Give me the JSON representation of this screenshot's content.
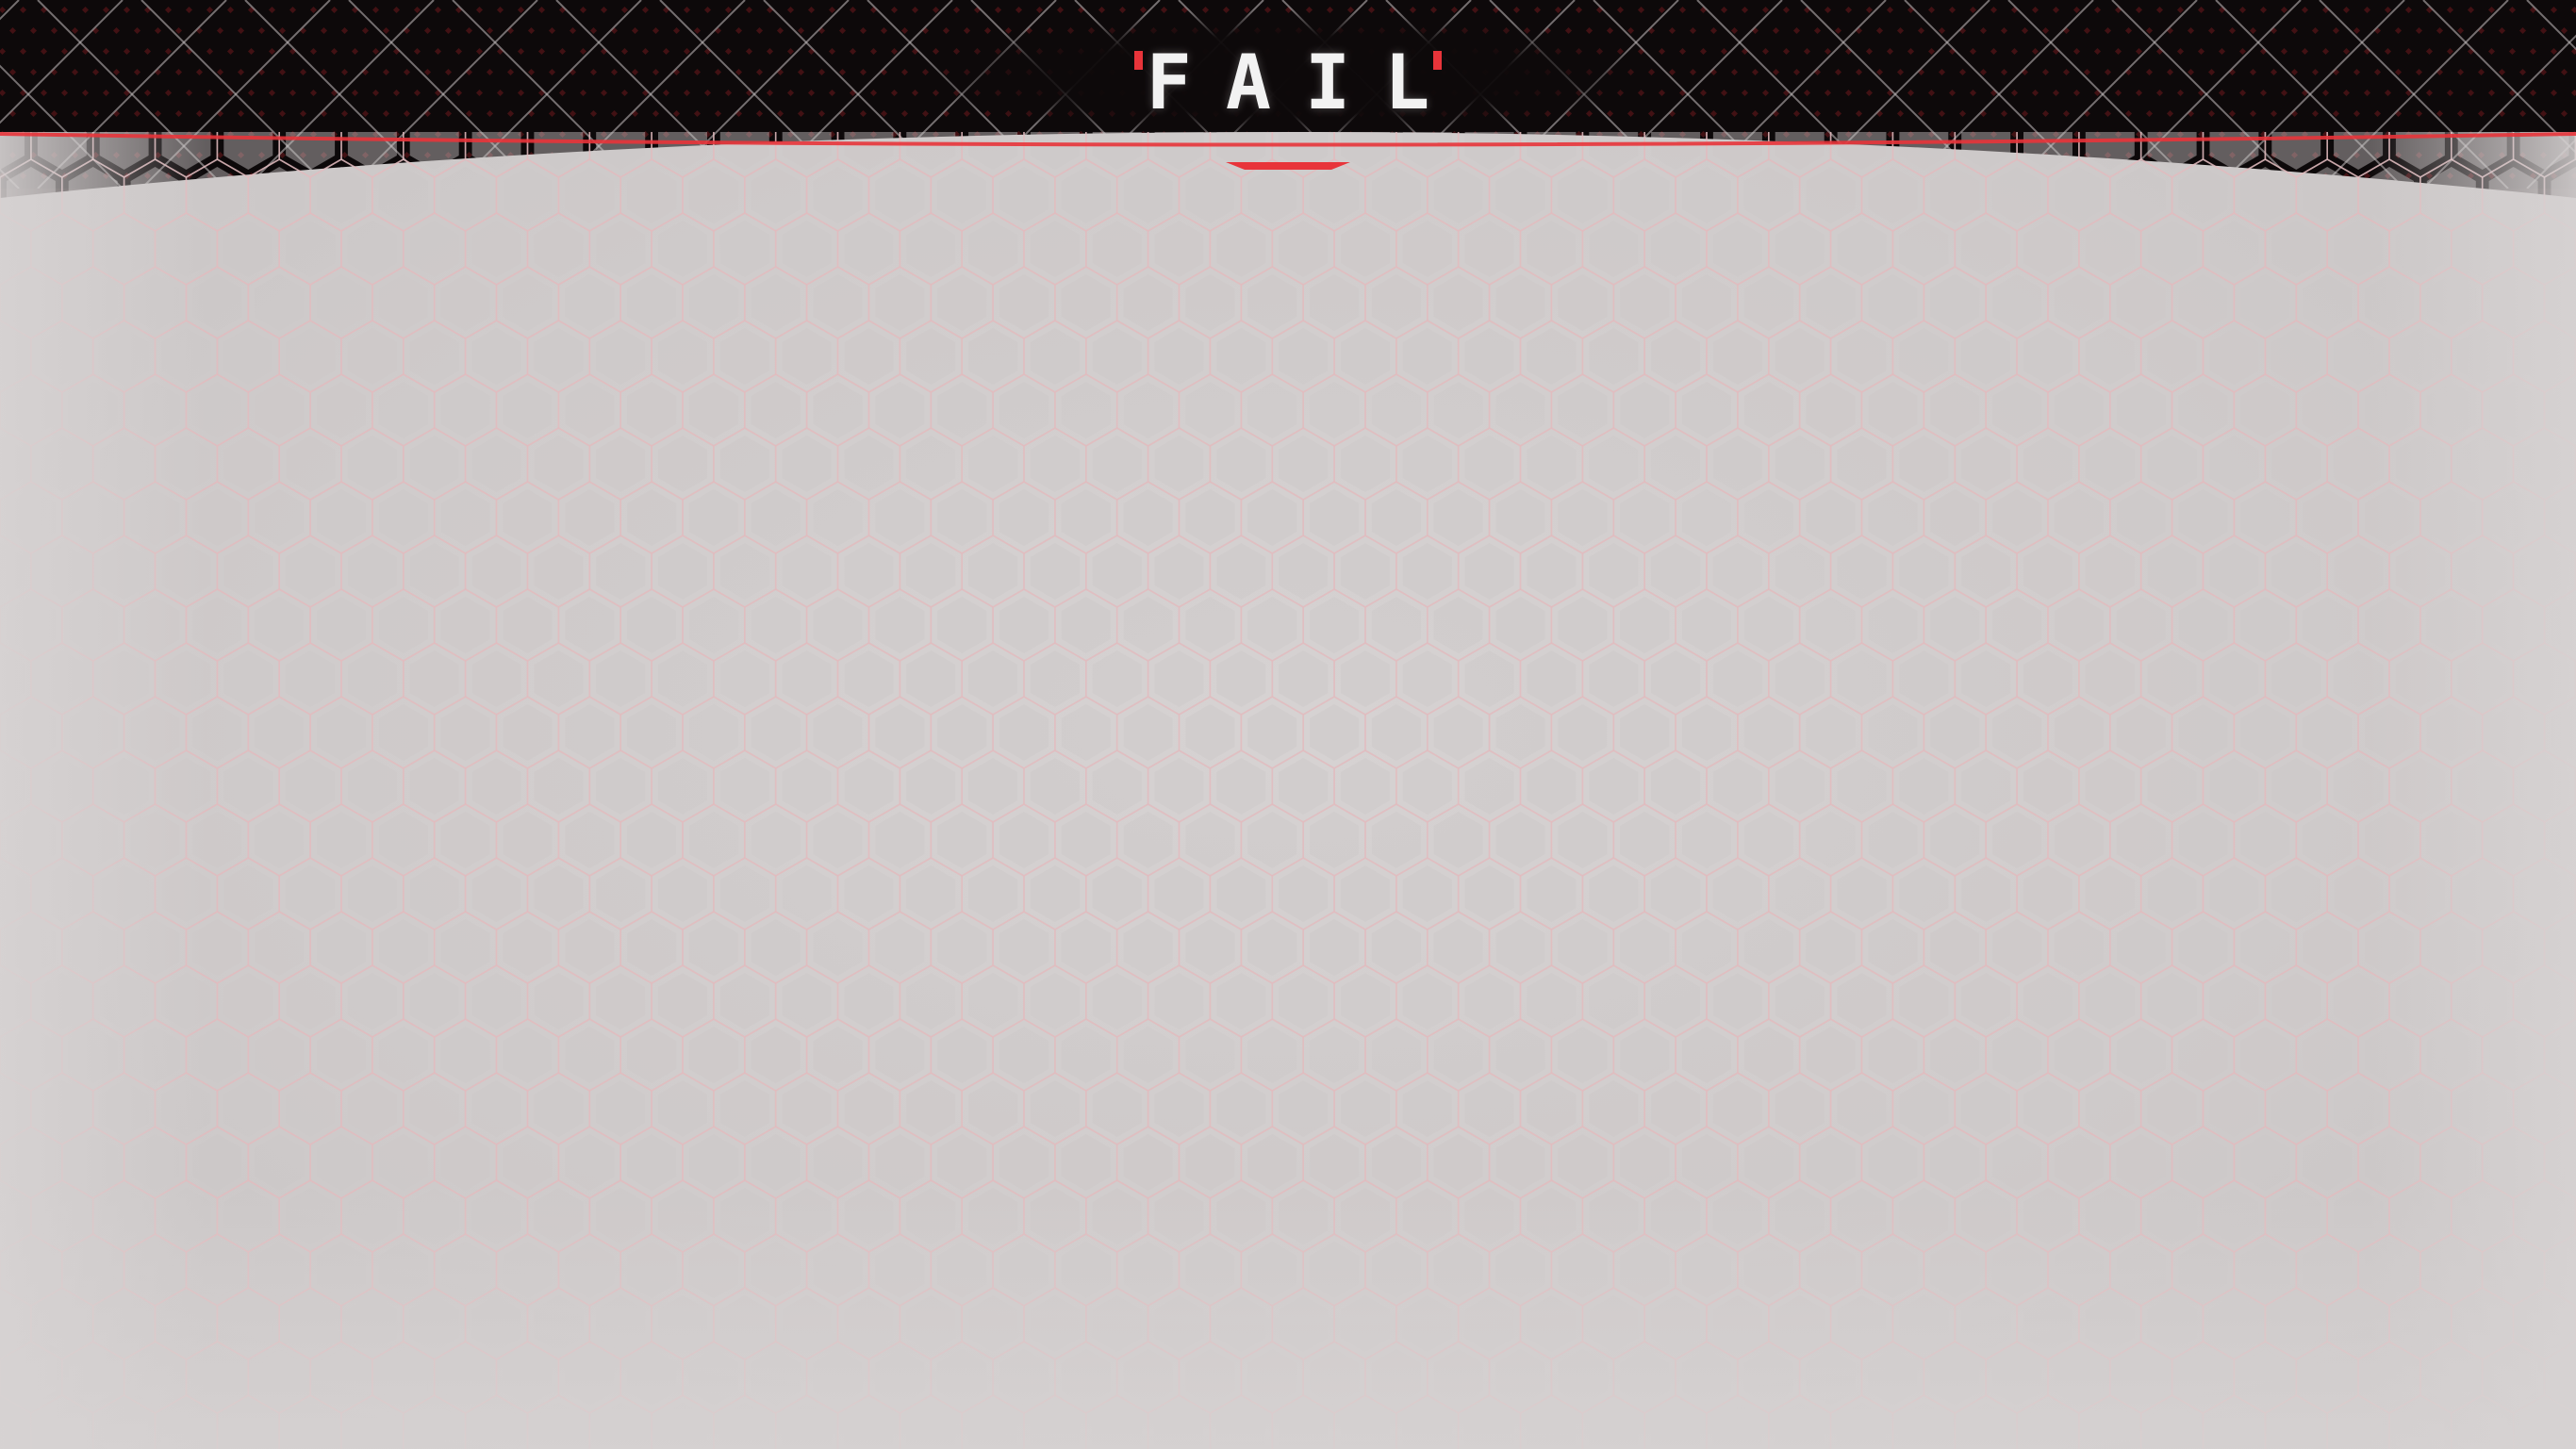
{
  "screen": {
    "result_title": "FAIL"
  },
  "colors": {
    "accent": "#e8343a",
    "banner_bg": "#0d090a",
    "panel_bg": "#d0cccc",
    "hex_outline": "#e3b9bc"
  },
  "icons": {
    "title_left_mark": "red-tick-mark",
    "title_right_mark": "red-tick-mark",
    "background_pattern": "hexagon-grid-pattern",
    "banner_pattern": "diamond-lattice-pattern"
  }
}
